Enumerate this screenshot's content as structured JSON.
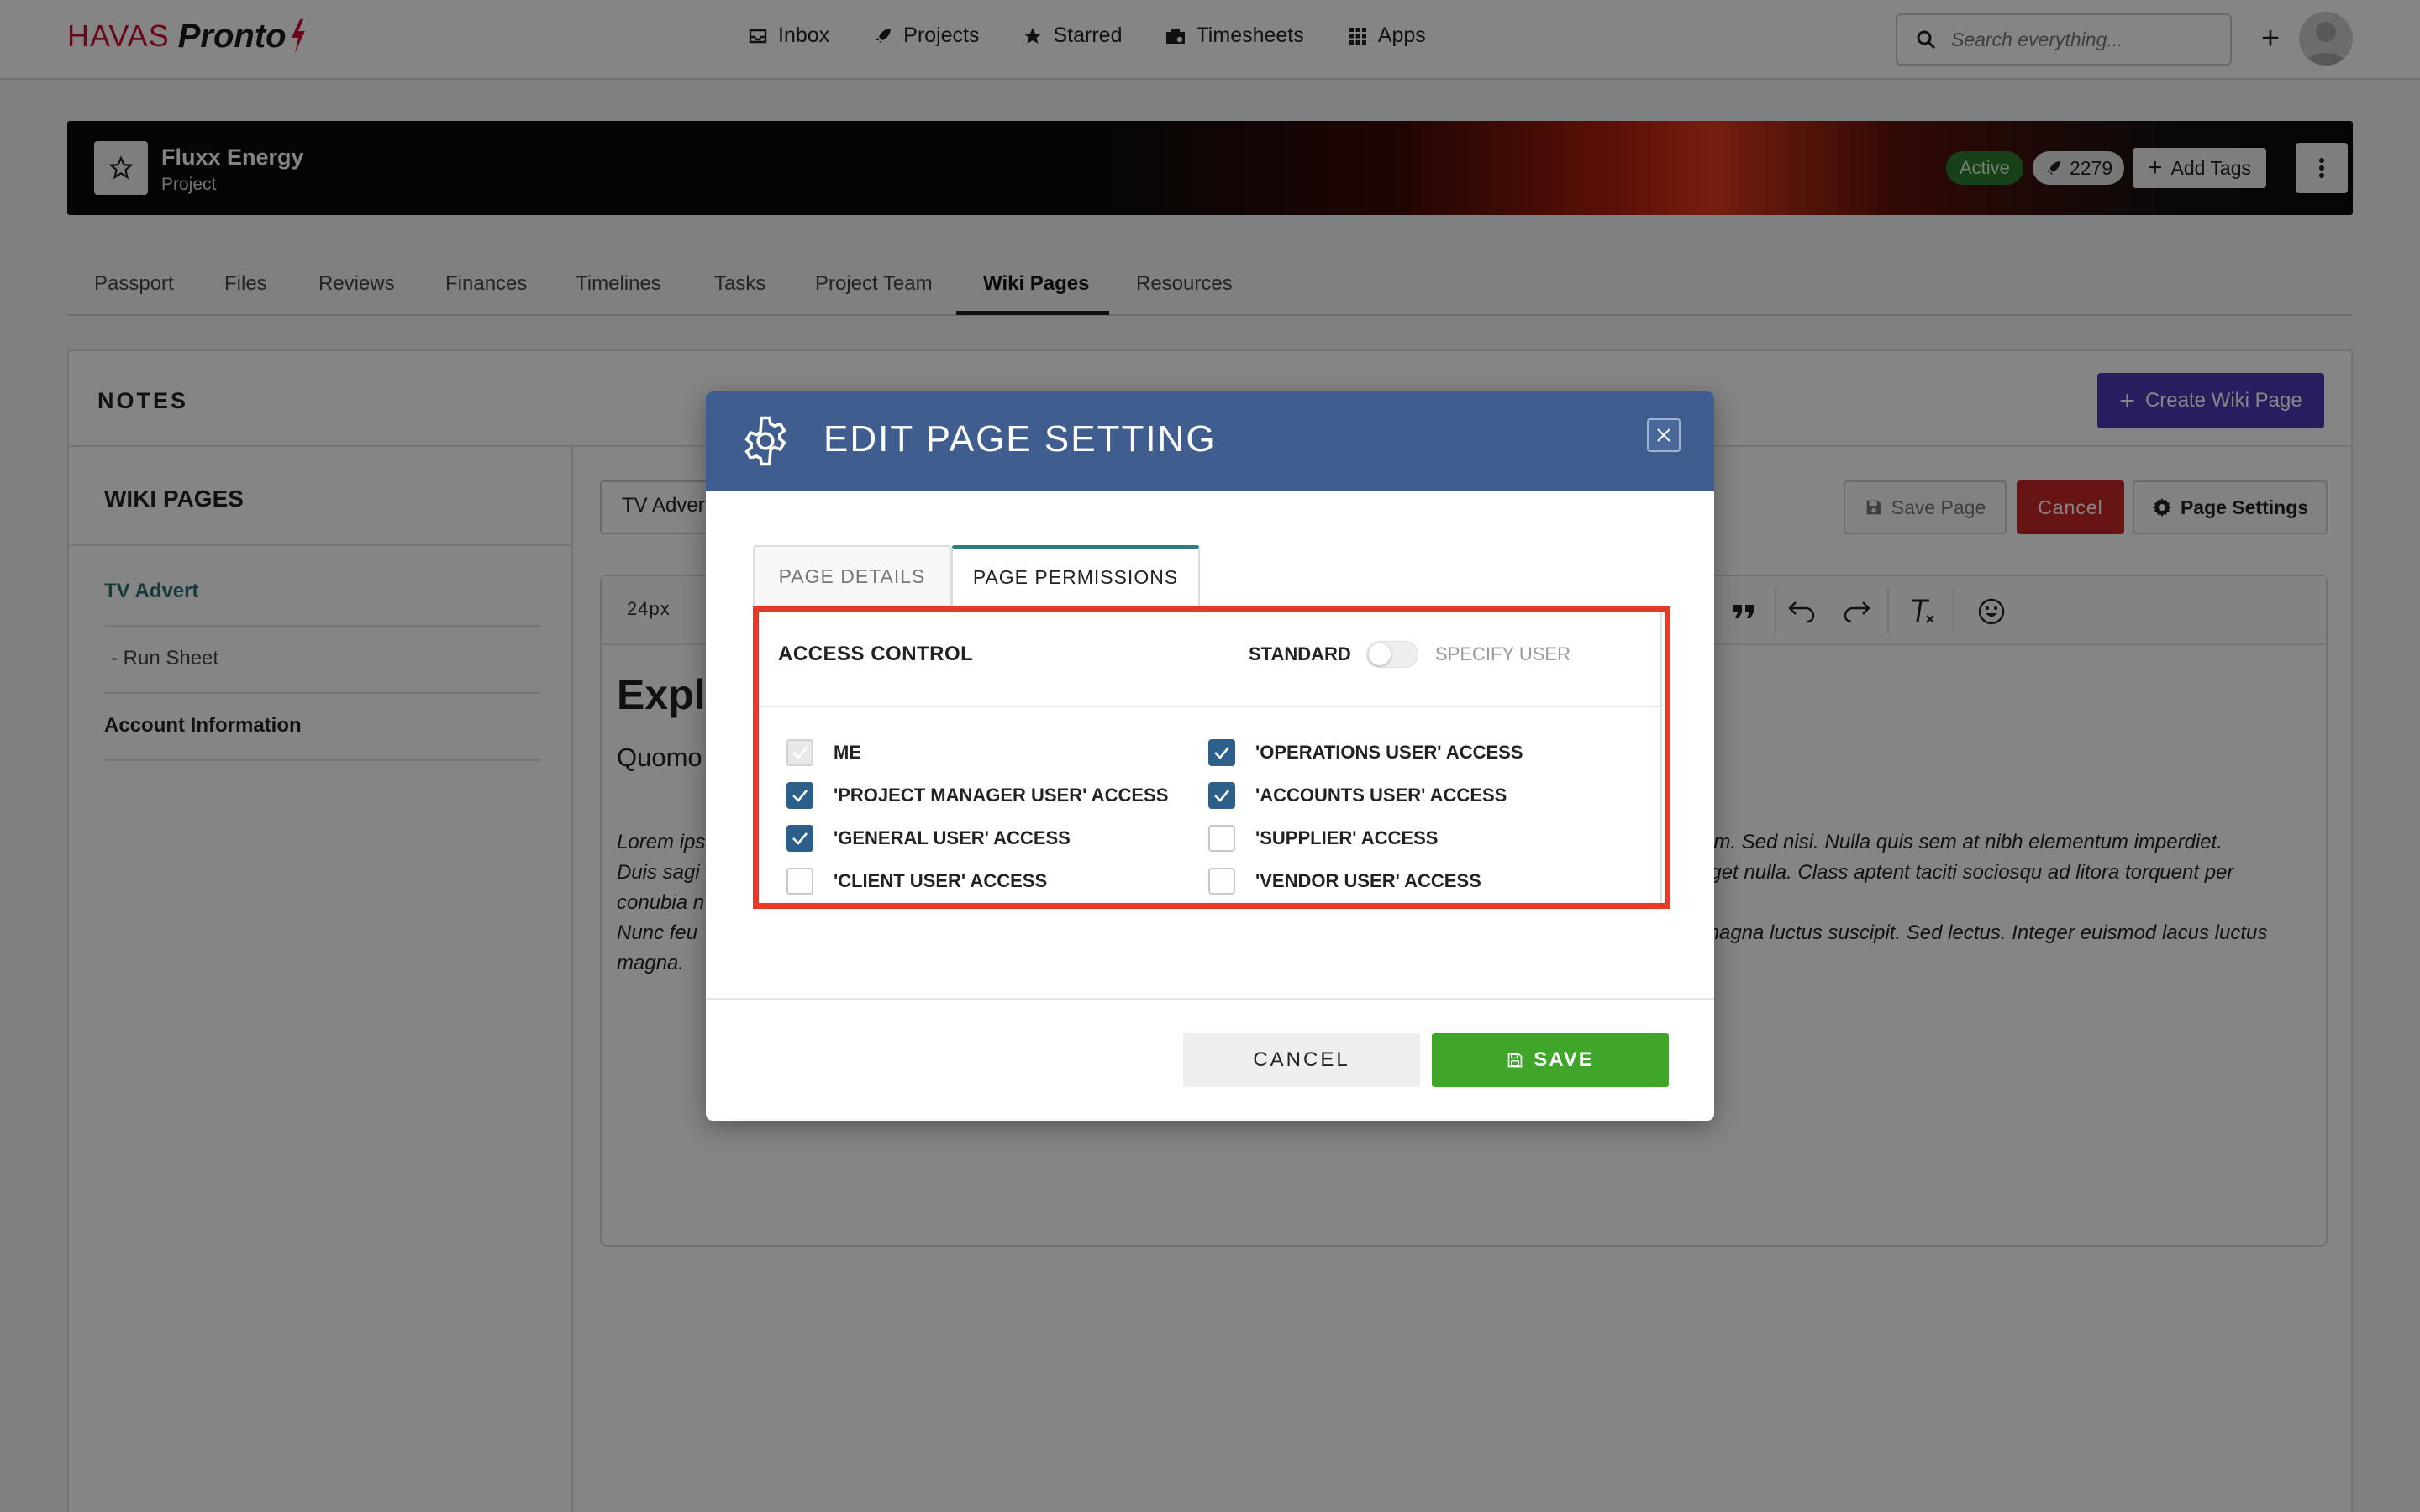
{
  "app": {
    "logo_brand": "HAVAS",
    "logo_product": "Pronto"
  },
  "nav": {
    "items": [
      {
        "label": "Inbox",
        "icon": "inbox-icon"
      },
      {
        "label": "Projects",
        "icon": "rocket-icon"
      },
      {
        "label": "Starred",
        "icon": "star-icon"
      },
      {
        "label": "Timesheets",
        "icon": "briefcase-icon"
      },
      {
        "label": "Apps",
        "icon": "grid-icon"
      }
    ],
    "search_placeholder": "Search everything...",
    "add_icon": "plus-icon"
  },
  "project": {
    "name": "Fluxx Energy",
    "type": "Project",
    "status": "Active",
    "count": "2279",
    "add_tags_label": "Add Tags"
  },
  "tabs": [
    "Passport",
    "Files",
    "Reviews",
    "Finances",
    "Timelines",
    "Tasks",
    "Project Team",
    "Wiki Pages",
    "Resources"
  ],
  "active_tab": "Wiki Pages",
  "notes": {
    "title": "NOTES",
    "create_label": "Create Wiki Page",
    "wiki_pages_title": "WIKI PAGES",
    "pages": [
      {
        "label": "TV Advert",
        "color": "#2a6f74"
      },
      {
        "label": "- Run Sheet",
        "color": "#444444"
      },
      {
        "label": "Account Information",
        "color": "#222222"
      }
    ],
    "page_title_value": "TV Advert",
    "save_page_label": "Save Page",
    "cancel_label": "Cancel",
    "page_settings_label": "Page Settings",
    "font_size": "24px",
    "heading": "Explo",
    "subheading": "Quomo",
    "para": [
      "Lorem ips",
      "Duis sagi",
      "conubia n",
      "Nunc feu",
      "magna."
    ],
    "para_right": [
      "am. Sed nisi. Nulla quis sem at nibh elementum imperdiet.",
      "eget nulla. Class aptent taciti sociosqu ad litora torquent per",
      "",
      "magna luctus suscipit. Sed lectus. Integer euismod lacus luctus",
      ""
    ]
  },
  "modal": {
    "title": "EDIT PAGE SETTING",
    "tab_details": "PAGE DETAILS",
    "tab_permissions": "PAGE PERMISSIONS",
    "access_control_label": "ACCESS CONTROL",
    "standard_label": "STANDARD",
    "specify_user_label": "SPECIFY USER",
    "specify_user_on": false,
    "permissions_left": [
      {
        "label": "ME",
        "checked": true,
        "disabled": true
      },
      {
        "label": "'PROJECT MANAGER USER' ACCESS",
        "checked": true,
        "disabled": false
      },
      {
        "label": "'GENERAL USER' ACCESS",
        "checked": true,
        "disabled": false
      },
      {
        "label": "'CLIENT USER' ACCESS",
        "checked": false,
        "disabled": false
      }
    ],
    "permissions_right": [
      {
        "label": "'OPERATIONS USER' ACCESS",
        "checked": true,
        "disabled": false
      },
      {
        "label": "'ACCOUNTS USER' ACCESS",
        "checked": true,
        "disabled": false
      },
      {
        "label": "'SUPPLIER' ACCESS",
        "checked": false,
        "disabled": false
      },
      {
        "label": "'VENDOR USER' ACCESS",
        "checked": false,
        "disabled": false
      }
    ],
    "cancel_label": "CANCEL",
    "save_label": "SAVE"
  },
  "colors": {
    "modal_header": "#3f5d8f",
    "checkbox_on": "#2c5f8a",
    "save_green": "#3fa62a",
    "cancel_red": "#c62828",
    "create_purple": "#4a3ab4",
    "highlight_red": "#e53a25",
    "active_badge": "#2e7d32"
  }
}
